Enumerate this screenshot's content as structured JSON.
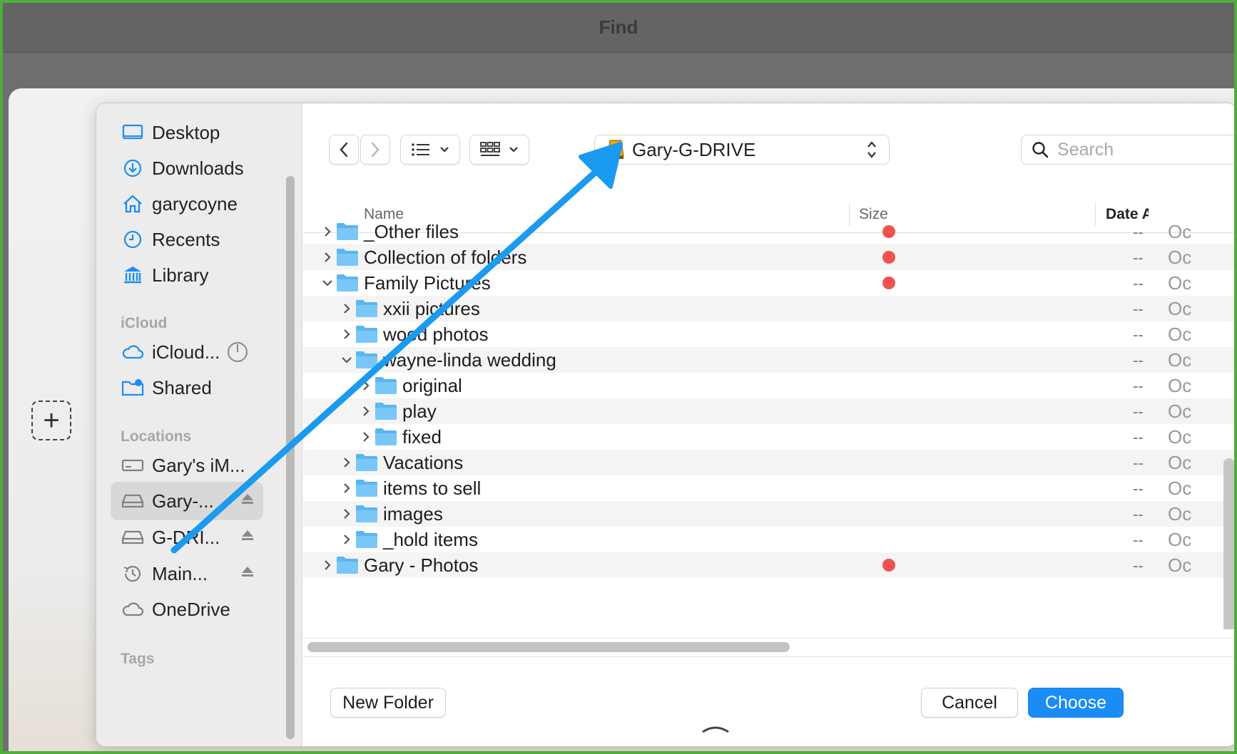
{
  "window": {
    "title": "Find"
  },
  "sidebar": {
    "favorites": [
      {
        "label": "Desktop",
        "icon": "desktop-icon"
      },
      {
        "label": "Downloads",
        "icon": "download-icon"
      },
      {
        "label": "garycoyne",
        "icon": "home-icon"
      },
      {
        "label": "Recents",
        "icon": "clock-icon"
      },
      {
        "label": "Library",
        "icon": "library-icon"
      }
    ],
    "icloud_header": "iCloud",
    "icloud": [
      {
        "label": "iCloud...",
        "icon": "cloud-icon"
      },
      {
        "label": "Shared",
        "icon": "shared-folder-icon"
      }
    ],
    "locations_header": "Locations",
    "locations": [
      {
        "label": "Gary's iM...",
        "icon": "drive-icon"
      },
      {
        "label": "Gary-...",
        "icon": "external-drive-icon",
        "selected": true
      },
      {
        "label": "G-DRI...",
        "icon": "external-drive-icon"
      },
      {
        "label": "Main...",
        "icon": "time-machine-icon"
      },
      {
        "label": "OneDrive",
        "icon": "cloud-icon"
      }
    ],
    "tags_header": "Tags"
  },
  "toolbar": {
    "location": "Gary-G-DRIVE",
    "search_placeholder": "Search"
  },
  "columns": {
    "name": "Name",
    "size": "Size",
    "date": "Date A"
  },
  "rows": [
    {
      "name": "_Other files",
      "level": 0,
      "expanded": false,
      "tag": true,
      "size": "--",
      "date": "Oc"
    },
    {
      "name": "Collection of folders",
      "level": 0,
      "expanded": false,
      "tag": true,
      "size": "--",
      "date": "Oc"
    },
    {
      "name": "Family Pictures",
      "level": 0,
      "expanded": true,
      "tag": true,
      "size": "--",
      "date": "Oc"
    },
    {
      "name": "xxii pictures",
      "level": 1,
      "expanded": false,
      "tag": false,
      "size": "--",
      "date": "Oc"
    },
    {
      "name": "wood photos",
      "level": 1,
      "expanded": false,
      "tag": false,
      "size": "--",
      "date": "Oc"
    },
    {
      "name": "wayne-linda wedding",
      "level": 1,
      "expanded": true,
      "tag": false,
      "size": "--",
      "date": "Oc"
    },
    {
      "name": "original",
      "level": 2,
      "expanded": false,
      "tag": false,
      "size": "--",
      "date": "Oc"
    },
    {
      "name": "play",
      "level": 2,
      "expanded": false,
      "tag": false,
      "size": "--",
      "date": "Oc"
    },
    {
      "name": "fixed",
      "level": 2,
      "expanded": false,
      "tag": false,
      "size": "--",
      "date": "Oc"
    },
    {
      "name": "Vacations",
      "level": 1,
      "expanded": false,
      "tag": false,
      "size": "--",
      "date": "Oc"
    },
    {
      "name": "items to sell",
      "level": 1,
      "expanded": false,
      "tag": false,
      "size": "--",
      "date": "Oc"
    },
    {
      "name": "images",
      "level": 1,
      "expanded": false,
      "tag": false,
      "size": "--",
      "date": "Oc"
    },
    {
      "name": "_hold items",
      "level": 1,
      "expanded": false,
      "tag": false,
      "size": "--",
      "date": "Oc"
    },
    {
      "name": "Gary - Photos",
      "level": 0,
      "expanded": false,
      "tag": true,
      "size": "--",
      "date": "Oc"
    }
  ],
  "buttons": {
    "new_folder": "New Folder",
    "cancel": "Cancel",
    "choose": "Choose"
  },
  "colors": {
    "accent": "#1a8cf5",
    "tag_red": "#f0524c",
    "annotation_arrow": "#1a9af0"
  }
}
